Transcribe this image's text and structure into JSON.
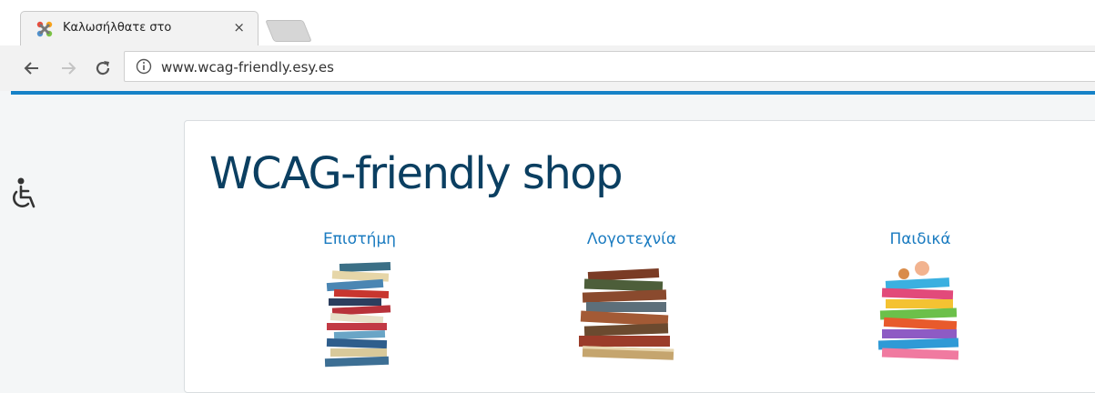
{
  "browser": {
    "tab": {
      "title": "Καλωσήλθατε στο",
      "favicon": "joomla-icon",
      "close_label": "×"
    },
    "address": {
      "url": "www.wcag-friendly.esy.es",
      "info_icon": "info-icon"
    },
    "nav": {
      "back_icon": "back-arrow-icon",
      "forward_icon": "forward-arrow-icon",
      "reload_icon": "reload-icon"
    },
    "accent_color": "#1682c7"
  },
  "page": {
    "accessibility_icon": "wheelchair-icon",
    "title": "WCAG-friendly shop",
    "title_color": "#0b3f61",
    "link_color": "#1a7bc0",
    "categories": [
      {
        "label": "Επιστήμη",
        "image": "book-stack-image"
      },
      {
        "label": "Λογοτεχνία",
        "image": "old-books-image"
      },
      {
        "label": "Παιδικά",
        "image": "kids-books-image"
      }
    ]
  }
}
